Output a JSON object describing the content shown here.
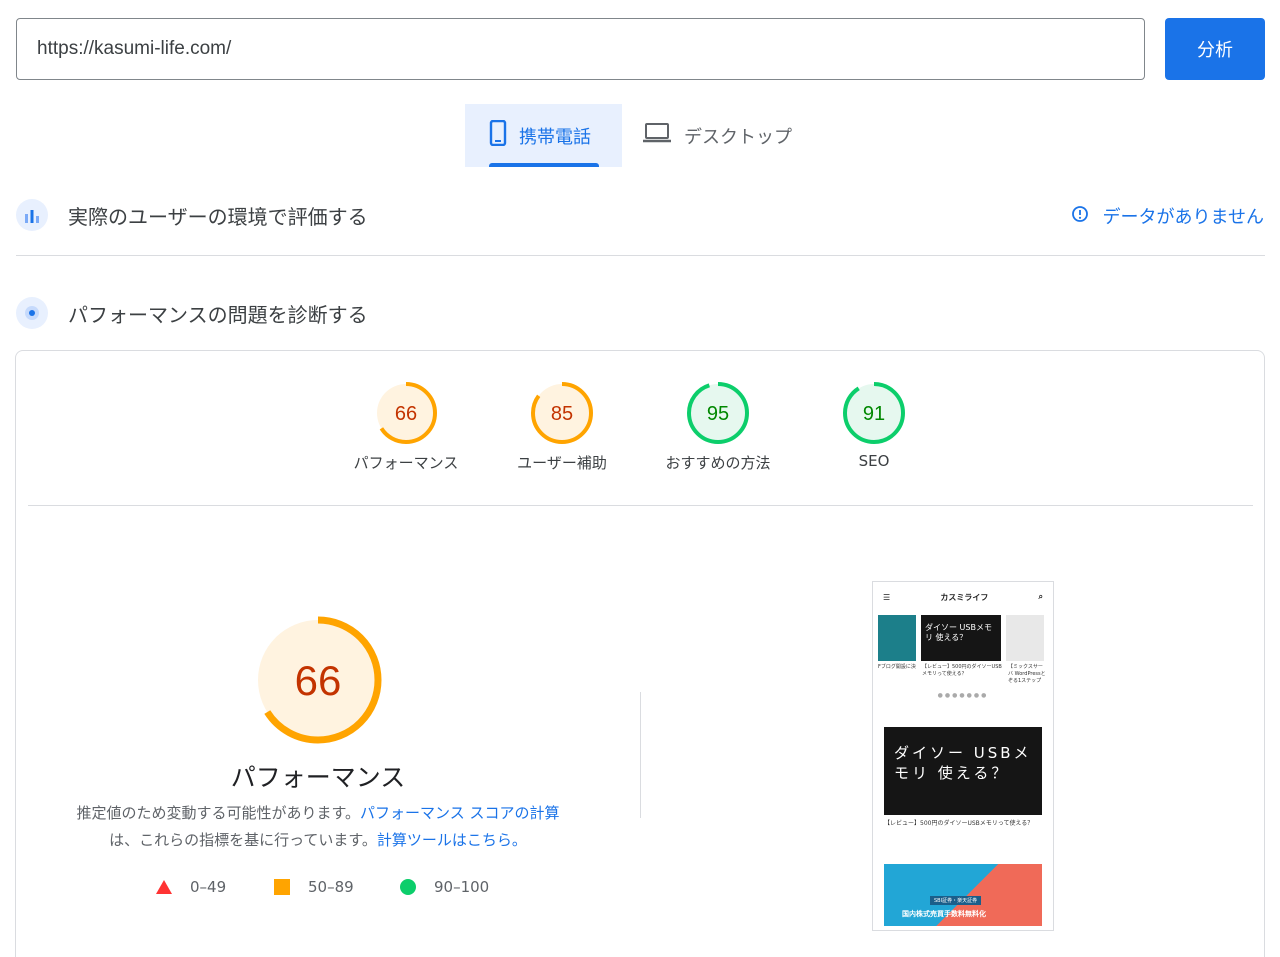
{
  "url_input": {
    "value": "https://kasumi-life.com/"
  },
  "analyze_button": {
    "label": "分析"
  },
  "device_tabs": [
    {
      "label": "携帯電話",
      "icon": "smartphone-icon",
      "selected": true
    },
    {
      "label": "デスクトップ",
      "icon": "laptop-icon",
      "selected": false
    }
  ],
  "field_data": {
    "title": "実際のユーザーの環境で評価する",
    "status": "データがありません",
    "status_icon": "info-icon"
  },
  "lab_data": {
    "title": "パフォーマンスの問題を診断する"
  },
  "scores": [
    {
      "value": "66",
      "label": "パフォーマンス",
      "fraction": 0.66,
      "color": "#ffa400",
      "text_color": "#c33300",
      "bg": "#fff3e0"
    },
    {
      "value": "85",
      "label": "ユーザー補助",
      "fraction": 0.85,
      "color": "#ffa400",
      "text_color": "#c33300",
      "bg": "#fff3e0"
    },
    {
      "value": "95",
      "label": "おすすめの方法",
      "fraction": 0.95,
      "color": "#0cce6b",
      "text_color": "#008800",
      "bg": "#e6f8ef"
    },
    {
      "value": "91",
      "label": "SEO",
      "fraction": 0.91,
      "color": "#0cce6b",
      "text_color": "#008800",
      "bg": "#e6f8ef"
    }
  ],
  "performance": {
    "score": "66",
    "fraction": 0.66,
    "title": "パフォーマンス",
    "desc_prefix": "推定値のため変動する可能性があります。",
    "desc_link1": "パフォーマンス スコアの計算",
    "desc_middle": "は、これらの指標を基に行っています。",
    "desc_link2": "計算ツールはこちら。"
  },
  "legend": [
    {
      "range": "0–49",
      "shape": "triangle",
      "color": "#ff3333"
    },
    {
      "range": "50–89",
      "shape": "square",
      "color": "#ffa400"
    },
    {
      "range": "90–100",
      "shape": "circle",
      "color": "#0cce6b"
    }
  ],
  "screenshot": {
    "site_name": "カスミライフ",
    "card1_caption": "Fブログ開設に決",
    "card2_caption": "【レビュー】500円のダイソーUSBメモリって使える？",
    "card3_caption": "【ミックスサーバ WordPressとぞる1ステップ",
    "hero_text": "ダイソー USBメモリ 使える？",
    "hero_caption": "【レビュー】500円のダイソーUSBメモリって使える？",
    "banner_tag": "SBI証券・楽天証券",
    "banner_text": "国内株式売買手数料無料化"
  }
}
